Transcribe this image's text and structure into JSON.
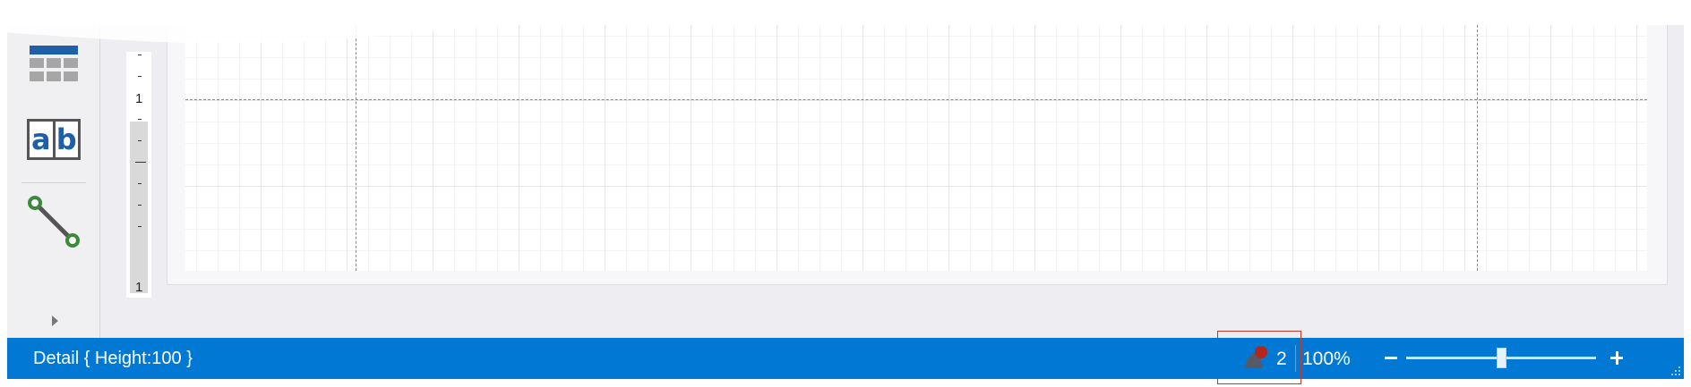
{
  "toolbox": {
    "table_icon": "table-icon",
    "label_icon": "label-icon",
    "label_glyph_a": "a",
    "label_glyph_b": "b",
    "line_icon": "line-icon",
    "expand_icon": "chevron-right-icon"
  },
  "ruler": {
    "upper_mark": "1",
    "lower_mark": "1"
  },
  "statusbar": {
    "selection_text": "Detail { Height:100 }",
    "notification_icon": "notification-bell-icon",
    "notification_count": "2",
    "zoom_level": "100%",
    "zoom_slider_fraction": 0.5,
    "zoom_out_icon": "minus-icon",
    "zoom_in_icon": "plus-icon"
  },
  "colors": {
    "statusbar_bg": "#0078d4",
    "accent_blue": "#1f5fa8",
    "line_green": "#3a8a3a",
    "notification_red": "#c0392b"
  }
}
